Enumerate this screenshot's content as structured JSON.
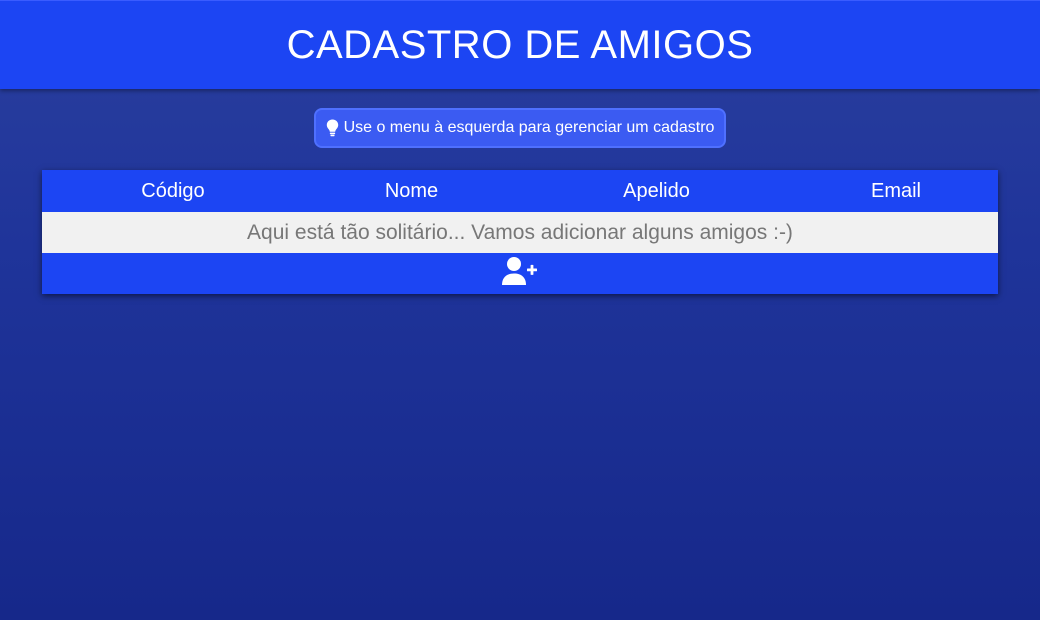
{
  "header": {
    "title": "CADASTRO DE AMIGOS"
  },
  "hint": {
    "icon": "lightbulb-icon",
    "text": "Use o menu à esquerda para gerenciar um cadastro"
  },
  "table": {
    "columns": [
      "Código",
      "Nome",
      "Apelido",
      "Email"
    ],
    "empty_message": "Aqui está tão solitário... Vamos adicionar alguns amigos :-)",
    "add_icon": "user-plus-icon"
  },
  "colors": {
    "primary": "#1c45f3",
    "hint_bg": "#3b5bf2",
    "empty_row_bg": "#f1f1f1",
    "empty_text": "#777777"
  }
}
